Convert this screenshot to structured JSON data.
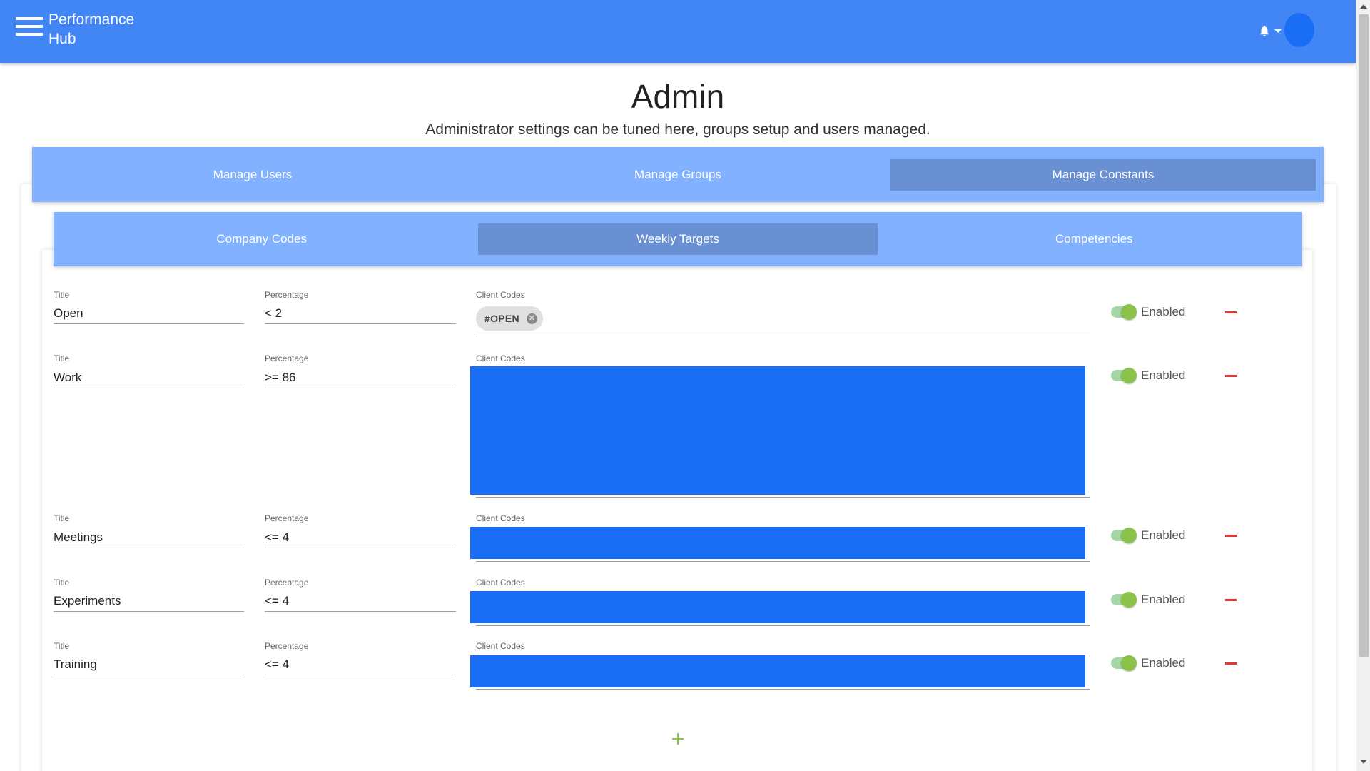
{
  "app": {
    "title_line1": "Performance",
    "title_line2": "Hub"
  },
  "page": {
    "title": "Admin",
    "subtitle": "Administrator settings can be tuned here, groups setup and users managed."
  },
  "tabs_main": [
    {
      "label": "Manage Users",
      "active": false
    },
    {
      "label": "Manage Groups",
      "active": false
    },
    {
      "label": "Manage Constants",
      "active": true
    }
  ],
  "tabs_sub": [
    {
      "label": "Company Codes",
      "active": false
    },
    {
      "label": "Weekly Targets",
      "active": true
    },
    {
      "label": "Competencies",
      "active": false
    }
  ],
  "labels": {
    "title": "Title",
    "percentage": "Percentage",
    "client_codes": "Client Codes",
    "enabled": "Enabled"
  },
  "targets": [
    {
      "title": "Open",
      "percentage": "< 2",
      "codes": [
        "#OPEN"
      ],
      "enabled": true
    },
    {
      "title": "Work",
      "percentage": ">= 86",
      "codes": [],
      "enabled": true
    },
    {
      "title": "Meetings",
      "percentage": "<= 4",
      "codes": [],
      "enabled": true
    },
    {
      "title": "Experiments",
      "percentage": "<= 4",
      "codes": [],
      "enabled": true
    },
    {
      "title": "Training",
      "percentage": "<= 4",
      "codes": [],
      "enabled": true
    }
  ],
  "colors": {
    "appbar": "#4285f4",
    "tabs": "#82b1ff",
    "tab_active": "#6a90d4",
    "codes_block": "#1a6ef5",
    "toggle_on": "#8bc34a",
    "remove": "#e53935"
  },
  "icons": {
    "menu": "menu-icon",
    "bell": "bell-icon",
    "chip_close": "close-circle-icon",
    "remove": "minus-icon",
    "add": "plus-icon"
  }
}
